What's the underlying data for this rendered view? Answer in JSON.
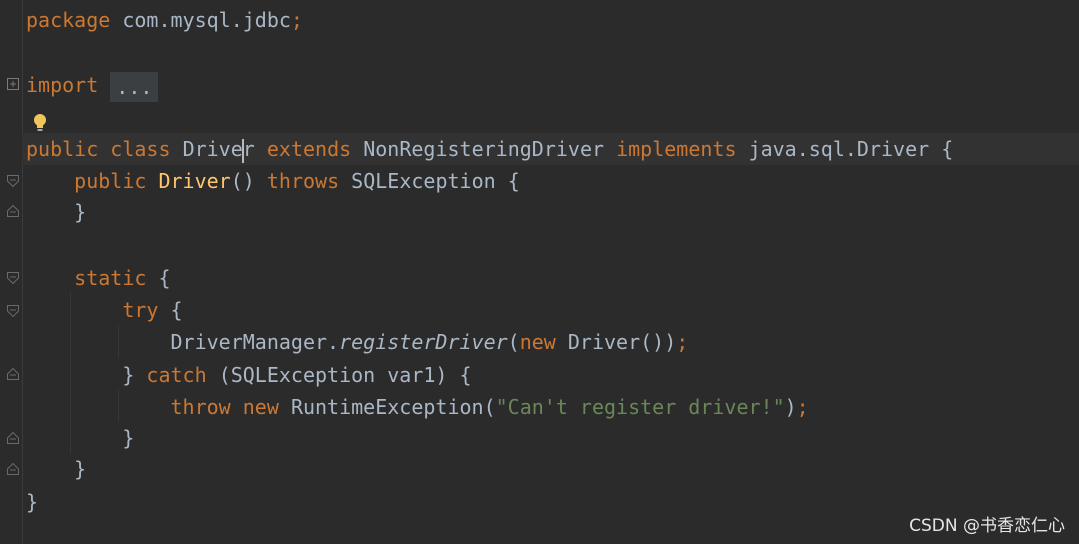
{
  "code": {
    "package_kw": "package",
    "package_name": "com.mysql.jdbc",
    "semicolon": ";",
    "import_kw": "import",
    "import_fold": "...",
    "public_kw": "public",
    "class_kw": "class",
    "class_name_a": "Drive",
    "class_name_b": "r",
    "extends_kw": "extends",
    "super_class": "NonRegisteringDriver",
    "implements_kw": "implements",
    "interface_name": "java.sql.Driver",
    "open_brace": "{",
    "close_brace": "}",
    "ctor_name": "Driver",
    "ctor_parens": "()",
    "throws_kw": "throws",
    "exception_type": "SQLException",
    "static_kw": "static",
    "try_kw": "try",
    "dm_class": "DriverManager.",
    "register_method": "registerDriver",
    "open_paren": "(",
    "new_kw": "new",
    "driver_call": "Driver())",
    "catch_kw": "catch",
    "catch_args": "(SQLException var1)",
    "throw_kw": "throw",
    "runtime_exc": "RuntimeException(",
    "message": "\"Can't register driver!\"",
    "close_paren": ")"
  },
  "watermark": "CSDN @书香恋仁心",
  "colors": {
    "background": "#2b2b2b",
    "keyword": "#cc7832",
    "function": "#ffc66d",
    "string": "#6a8759",
    "text": "#a9b7c6"
  },
  "icons": [
    "lightbulb-icon",
    "fold-icon"
  ]
}
